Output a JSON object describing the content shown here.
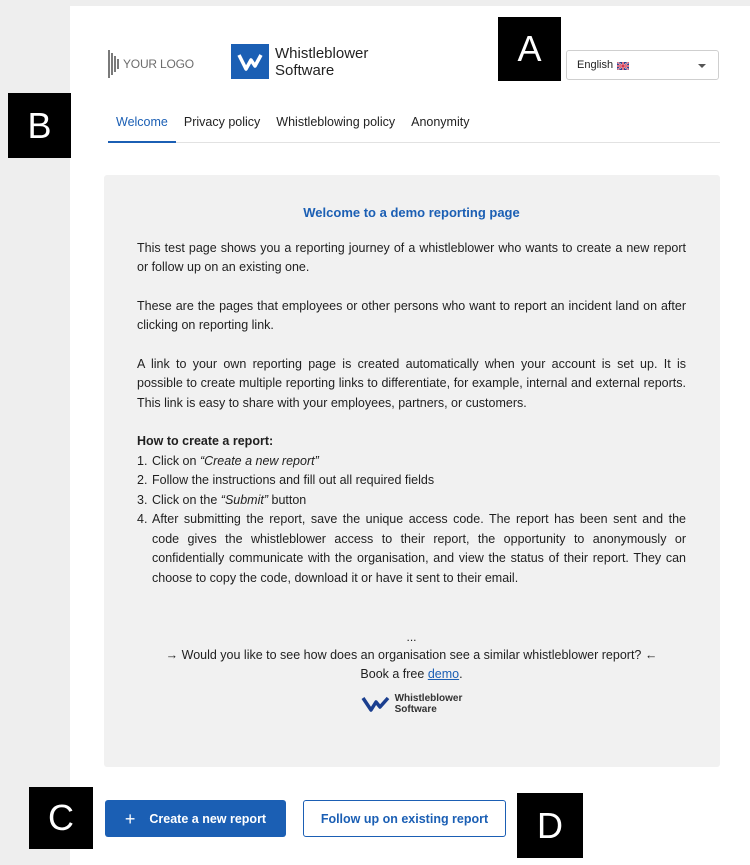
{
  "header": {
    "placeholder_logo_text": "YOUR LOGO",
    "brand_line1": "Whistleblower",
    "brand_line2": "Software",
    "brand_color": "#1b5fb4"
  },
  "language_select": {
    "value": "English",
    "flag_icon": "uk-flag-icon"
  },
  "tabs": [
    {
      "label": "Welcome",
      "active": true
    },
    {
      "label": "Privacy policy",
      "active": false
    },
    {
      "label": "Whistleblowing policy",
      "active": false
    },
    {
      "label": "Anonymity",
      "active": false
    }
  ],
  "content": {
    "title": "Welcome to a demo reporting page",
    "paragraphs": [
      "This test page shows you a reporting journey of a whistleblower who wants to create a new report or follow up on an existing one.",
      "These are the pages that employees or other persons who want to report an incident land on after clicking on reporting link.",
      "A link to your own reporting page is created automatically when your account is set up. It is possible to create multiple reporting links to differentiate, for example, internal and external reports. This link is easy to share with your employees, partners, or customers."
    ],
    "howto_title": "How to create a report:",
    "steps": [
      {
        "num": "1.",
        "pre": "Click on ",
        "em": "“Create a new report”",
        "post": ""
      },
      {
        "num": "2.",
        "pre": "Follow the instructions and fill out all required fields",
        "em": "",
        "post": ""
      },
      {
        "num": "3.",
        "pre": "Click on the ",
        "em": "“Submit”",
        "post": " button"
      },
      {
        "num": "4.",
        "pre": "After submitting the report, save the unique access code. The report has been sent and the code gives the whistleblower access to their report, the opportunity to anonymously or confidentially communicate with the organisation, and view the status of their report. They can choose to copy the code, download it or have it sent to their email.",
        "em": "",
        "post": ""
      }
    ],
    "ellipsis": "...",
    "demo_question": "→ Would you like to see how does an organisation see a similar whistleblower report? ←",
    "demo_prefix": "Book a free ",
    "demo_link": "demo",
    "demo_suffix": ".",
    "mini_brand_line1": "Whistleblower",
    "mini_brand_line2": "Software"
  },
  "actions": {
    "create_label": "Create a new report",
    "create_icon": "plus-icon",
    "follow_up_label": "Follow up on existing report"
  },
  "markers": [
    "A",
    "B",
    "C",
    "D"
  ]
}
